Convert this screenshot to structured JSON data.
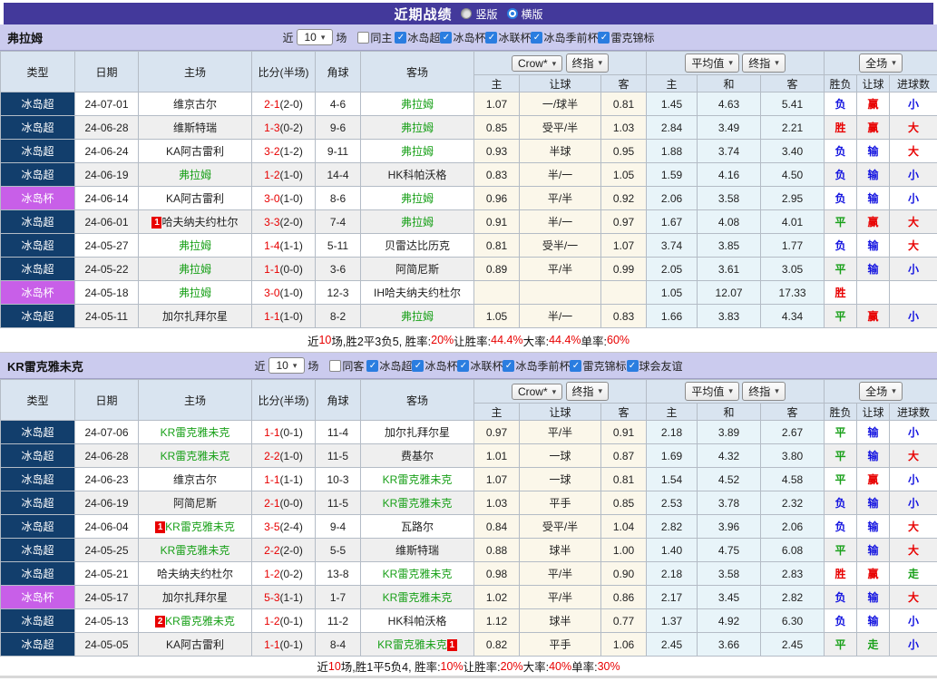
{
  "title_bar": {
    "title": "近期战绩",
    "vertical": "竖版",
    "horizontal": "横版"
  },
  "colors": {
    "title_bg": "#43399b",
    "filter_bg": "#cbcbee",
    "header_bg": "#d9e4f0",
    "league_badge": "#123e6c",
    "cup_badge": "#c85fe8",
    "team_green": "#18a018",
    "win_red": "#e80000",
    "lose_blue": "#1414e0",
    "odds_bg": "#fbf7ea",
    "avg_bg": "#e8f4f9"
  },
  "sections": [
    {
      "team": "弗拉姆",
      "filter": {
        "prefix": "近",
        "count": "10",
        "suffix": "场",
        "same_label": "同主",
        "competitions": [
          "冰岛超",
          "冰岛杯",
          "冰联杯",
          "冰岛季前杯",
          "雷克锦标"
        ]
      },
      "dropdowns": {
        "provider": "Crow*",
        "stage1": "终指",
        "avg": "平均值",
        "stage2": "终指",
        "scope": "全场"
      },
      "columns": [
        "类型",
        "日期",
        "主场",
        "比分(半场)",
        "角球",
        "客场"
      ],
      "sub_columns": [
        "主",
        "让球",
        "客",
        "主",
        "和",
        "客",
        "胜负",
        "让球",
        "进球数"
      ],
      "rows": [
        {
          "lg": "冰岛超",
          "cup": false,
          "date": "24-07-01",
          "home": "维京古尔",
          "hg": false,
          "hb": "",
          "score": "2-1",
          "half": "(2-0)",
          "corner": "4-6",
          "away": "弗拉姆",
          "ag": true,
          "ab": "",
          "aba": "",
          "o": [
            "1.07",
            "一/球半",
            "0.81",
            "1.45",
            "4.63",
            "5.41"
          ],
          "res": [
            [
              "负",
              "b"
            ],
            [
              "赢",
              "r"
            ],
            [
              "小",
              "b"
            ]
          ]
        },
        {
          "lg": "冰岛超",
          "cup": false,
          "date": "24-06-28",
          "home": "维斯特瑞",
          "hg": false,
          "hb": "",
          "score": "1-3",
          "half": "(0-2)",
          "corner": "9-6",
          "away": "弗拉姆",
          "ag": true,
          "ab": "",
          "aba": "",
          "o": [
            "0.85",
            "受平/半",
            "1.03",
            "2.84",
            "3.49",
            "2.21"
          ],
          "res": [
            [
              "胜",
              "r"
            ],
            [
              "赢",
              "r"
            ],
            [
              "大",
              "r"
            ]
          ]
        },
        {
          "lg": "冰岛超",
          "cup": false,
          "date": "24-06-24",
          "home": "KA阿古雷利",
          "hg": false,
          "hb": "",
          "score": "3-2",
          "half": "(1-2)",
          "corner": "9-11",
          "away": "弗拉姆",
          "ag": true,
          "ab": "",
          "aba": "",
          "o": [
            "0.93",
            "半球",
            "0.95",
            "1.88",
            "3.74",
            "3.40"
          ],
          "res": [
            [
              "负",
              "b"
            ],
            [
              "输",
              "b"
            ],
            [
              "大",
              "r"
            ]
          ]
        },
        {
          "lg": "冰岛超",
          "cup": false,
          "date": "24-06-19",
          "home": "弗拉姆",
          "hg": true,
          "hb": "",
          "score": "1-2",
          "half": "(1-0)",
          "corner": "14-4",
          "away": "HK科帕沃格",
          "ag": false,
          "ab": "",
          "aba": "",
          "o": [
            "0.83",
            "半/一",
            "1.05",
            "1.59",
            "4.16",
            "4.50"
          ],
          "res": [
            [
              "负",
              "b"
            ],
            [
              "输",
              "b"
            ],
            [
              "小",
              "b"
            ]
          ]
        },
        {
          "lg": "冰岛杯",
          "cup": true,
          "date": "24-06-14",
          "home": "KA阿古雷利",
          "hg": false,
          "hb": "",
          "score": "3-0",
          "half": "(1-0)",
          "corner": "8-6",
          "away": "弗拉姆",
          "ag": true,
          "ab": "",
          "aba": "",
          "o": [
            "0.96",
            "平/半",
            "0.92",
            "2.06",
            "3.58",
            "2.95"
          ],
          "res": [
            [
              "负",
              "b"
            ],
            [
              "输",
              "b"
            ],
            [
              "小",
              "b"
            ]
          ]
        },
        {
          "lg": "冰岛超",
          "cup": false,
          "date": "24-06-01",
          "home": "哈夫纳夫约杜尔",
          "hg": false,
          "hb": "1",
          "score": "3-3",
          "half": "(2-0)",
          "corner": "7-4",
          "away": "弗拉姆",
          "ag": true,
          "ab": "",
          "aba": "",
          "o": [
            "0.91",
            "半/一",
            "0.97",
            "1.67",
            "4.08",
            "4.01"
          ],
          "res": [
            [
              "平",
              "g"
            ],
            [
              "赢",
              "r"
            ],
            [
              "大",
              "r"
            ]
          ]
        },
        {
          "lg": "冰岛超",
          "cup": false,
          "date": "24-05-27",
          "home": "弗拉姆",
          "hg": true,
          "hb": "",
          "score": "1-4",
          "half": "(1-1)",
          "corner": "5-11",
          "away": "贝雷达比历克",
          "ag": false,
          "ab": "",
          "aba": "",
          "o": [
            "0.81",
            "受半/一",
            "1.07",
            "3.74",
            "3.85",
            "1.77"
          ],
          "res": [
            [
              "负",
              "b"
            ],
            [
              "输",
              "b"
            ],
            [
              "大",
              "r"
            ]
          ]
        },
        {
          "lg": "冰岛超",
          "cup": false,
          "date": "24-05-22",
          "home": "弗拉姆",
          "hg": true,
          "hb": "",
          "score": "1-1",
          "half": "(0-0)",
          "corner": "3-6",
          "away": "阿简尼斯",
          "ag": false,
          "ab": "",
          "aba": "",
          "o": [
            "0.89",
            "平/半",
            "0.99",
            "2.05",
            "3.61",
            "3.05"
          ],
          "res": [
            [
              "平",
              "g"
            ],
            [
              "输",
              "b"
            ],
            [
              "小",
              "b"
            ]
          ]
        },
        {
          "lg": "冰岛杯",
          "cup": true,
          "date": "24-05-18",
          "home": "弗拉姆",
          "hg": true,
          "hb": "",
          "score": "3-0",
          "half": "(1-0)",
          "corner": "12-3",
          "away": "IH哈夫纳夫约杜尔",
          "ag": false,
          "ab": "",
          "aba": "",
          "o": [
            "",
            "",
            "",
            "1.05",
            "12.07",
            "17.33"
          ],
          "res": [
            [
              "胜",
              "r"
            ],
            [
              "",
              ""
            ],
            [
              "",
              ""
            ]
          ]
        },
        {
          "lg": "冰岛超",
          "cup": false,
          "date": "24-05-11",
          "home": "加尔扎拜尔星",
          "hg": false,
          "hb": "",
          "score": "1-1",
          "half": "(1-0)",
          "corner": "8-2",
          "away": "弗拉姆",
          "ag": true,
          "ab": "",
          "aba": "",
          "o": [
            "1.05",
            "半/一",
            "0.83",
            "1.66",
            "3.83",
            "4.34"
          ],
          "res": [
            [
              "平",
              "g"
            ],
            [
              "赢",
              "r"
            ],
            [
              "小",
              "b"
            ]
          ]
        }
      ],
      "summary_parts": [
        [
          "近",
          0
        ],
        [
          "10",
          1
        ],
        [
          "场,胜2平3负5, 胜率:",
          0
        ],
        [
          "20%",
          1
        ],
        [
          " 让胜率:",
          0
        ],
        [
          "44.4%",
          1
        ],
        [
          " 大率:",
          0
        ],
        [
          "44.4%",
          1
        ],
        [
          " 单率:",
          0
        ],
        [
          "60%",
          1
        ]
      ]
    },
    {
      "team": "KR雷克雅未克",
      "filter": {
        "prefix": "近",
        "count": "10",
        "suffix": "场",
        "same_label": "同客",
        "competitions": [
          "冰岛超",
          "冰岛杯",
          "冰联杯",
          "冰岛季前杯",
          "雷克锦标",
          "球会友谊"
        ]
      },
      "dropdowns": {
        "provider": "Crow*",
        "stage1": "终指",
        "avg": "平均值",
        "stage2": "终指",
        "scope": "全场"
      },
      "columns": [
        "类型",
        "日期",
        "主场",
        "比分(半场)",
        "角球",
        "客场"
      ],
      "sub_columns": [
        "主",
        "让球",
        "客",
        "主",
        "和",
        "客",
        "胜负",
        "让球",
        "进球数"
      ],
      "rows": [
        {
          "lg": "冰岛超",
          "cup": false,
          "date": "24-07-06",
          "home": "KR雷克雅未克",
          "hg": true,
          "hb": "",
          "score": "1-1",
          "half": "(0-1)",
          "corner": "11-4",
          "away": "加尔扎拜尔星",
          "ag": false,
          "ab": "",
          "aba": "",
          "o": [
            "0.97",
            "平/半",
            "0.91",
            "2.18",
            "3.89",
            "2.67"
          ],
          "res": [
            [
              "平",
              "g"
            ],
            [
              "输",
              "b"
            ],
            [
              "小",
              "b"
            ]
          ]
        },
        {
          "lg": "冰岛超",
          "cup": false,
          "date": "24-06-28",
          "home": "KR雷克雅未克",
          "hg": true,
          "hb": "",
          "score": "2-2",
          "half": "(1-0)",
          "corner": "11-5",
          "away": "费基尔",
          "ag": false,
          "ab": "",
          "aba": "",
          "o": [
            "1.01",
            "一球",
            "0.87",
            "1.69",
            "4.32",
            "3.80"
          ],
          "res": [
            [
              "平",
              "g"
            ],
            [
              "输",
              "b"
            ],
            [
              "大",
              "r"
            ]
          ]
        },
        {
          "lg": "冰岛超",
          "cup": false,
          "date": "24-06-23",
          "home": "维京古尔",
          "hg": false,
          "hb": "",
          "score": "1-1",
          "half": "(1-1)",
          "corner": "10-3",
          "away": "KR雷克雅未克",
          "ag": true,
          "ab": "",
          "aba": "",
          "o": [
            "1.07",
            "一球",
            "0.81",
            "1.54",
            "4.52",
            "4.58"
          ],
          "res": [
            [
              "平",
              "g"
            ],
            [
              "赢",
              "r"
            ],
            [
              "小",
              "b"
            ]
          ]
        },
        {
          "lg": "冰岛超",
          "cup": false,
          "date": "24-06-19",
          "home": "阿简尼斯",
          "hg": false,
          "hb": "",
          "score": "2-1",
          "half": "(0-0)",
          "corner": "11-5",
          "away": "KR雷克雅未克",
          "ag": true,
          "ab": "",
          "aba": "",
          "o": [
            "1.03",
            "平手",
            "0.85",
            "2.53",
            "3.78",
            "2.32"
          ],
          "res": [
            [
              "负",
              "b"
            ],
            [
              "输",
              "b"
            ],
            [
              "小",
              "b"
            ]
          ]
        },
        {
          "lg": "冰岛超",
          "cup": false,
          "date": "24-06-04",
          "home": "KR雷克雅未克",
          "hg": true,
          "hb": "1",
          "score": "3-5",
          "half": "(2-4)",
          "corner": "9-4",
          "away": "瓦路尔",
          "ag": false,
          "ab": "",
          "aba": "",
          "o": [
            "0.84",
            "受平/半",
            "1.04",
            "2.82",
            "3.96",
            "2.06"
          ],
          "res": [
            [
              "负",
              "b"
            ],
            [
              "输",
              "b"
            ],
            [
              "大",
              "r"
            ]
          ]
        },
        {
          "lg": "冰岛超",
          "cup": false,
          "date": "24-05-25",
          "home": "KR雷克雅未克",
          "hg": true,
          "hb": "",
          "score": "2-2",
          "half": "(2-0)",
          "corner": "5-5",
          "away": "维斯特瑞",
          "ag": false,
          "ab": "",
          "aba": "",
          "o": [
            "0.88",
            "球半",
            "1.00",
            "1.40",
            "4.75",
            "6.08"
          ],
          "res": [
            [
              "平",
              "g"
            ],
            [
              "输",
              "b"
            ],
            [
              "大",
              "r"
            ]
          ]
        },
        {
          "lg": "冰岛超",
          "cup": false,
          "date": "24-05-21",
          "home": "哈夫纳夫约杜尔",
          "hg": false,
          "hb": "",
          "score": "1-2",
          "half": "(0-2)",
          "corner": "13-8",
          "away": "KR雷克雅未克",
          "ag": true,
          "ab": "",
          "aba": "",
          "o": [
            "0.98",
            "平/半",
            "0.90",
            "2.18",
            "3.58",
            "2.83"
          ],
          "res": [
            [
              "胜",
              "r"
            ],
            [
              "赢",
              "r"
            ],
            [
              "走",
              "g"
            ]
          ]
        },
        {
          "lg": "冰岛杯",
          "cup": true,
          "date": "24-05-17",
          "home": "加尔扎拜尔星",
          "hg": false,
          "hb": "",
          "score": "5-3",
          "half": "(1-1)",
          "corner": "1-7",
          "away": "KR雷克雅未克",
          "ag": true,
          "ab": "",
          "aba": "",
          "o": [
            "1.02",
            "平/半",
            "0.86",
            "2.17",
            "3.45",
            "2.82"
          ],
          "res": [
            [
              "负",
              "b"
            ],
            [
              "输",
              "b"
            ],
            [
              "大",
              "r"
            ]
          ]
        },
        {
          "lg": "冰岛超",
          "cup": false,
          "date": "24-05-13",
          "home": "KR雷克雅未克",
          "hg": true,
          "hb": "2",
          "score": "1-2",
          "half": "(0-1)",
          "corner": "11-2",
          "away": "HK科帕沃格",
          "ag": false,
          "ab": "",
          "aba": "",
          "o": [
            "1.12",
            "球半",
            "0.77",
            "1.37",
            "4.92",
            "6.30"
          ],
          "res": [
            [
              "负",
              "b"
            ],
            [
              "输",
              "b"
            ],
            [
              "小",
              "b"
            ]
          ]
        },
        {
          "lg": "冰岛超",
          "cup": false,
          "date": "24-05-05",
          "home": "KA阿古雷利",
          "hg": false,
          "hb": "",
          "score": "1-1",
          "half": "(0-1)",
          "corner": "8-4",
          "away": "KR雷克雅未克",
          "ag": true,
          "ab": "",
          "aba": "1",
          "o": [
            "0.82",
            "平手",
            "1.06",
            "2.45",
            "3.66",
            "2.45"
          ],
          "res": [
            [
              "平",
              "g"
            ],
            [
              "走",
              "g"
            ],
            [
              "小",
              "b"
            ]
          ]
        }
      ],
      "summary_parts": [
        [
          "近",
          0
        ],
        [
          "10",
          1
        ],
        [
          "场,胜1平5负4, 胜率:",
          0
        ],
        [
          "10%",
          1
        ],
        [
          " 让胜率:",
          0
        ],
        [
          "20%",
          1
        ],
        [
          " 大率:",
          0
        ],
        [
          "40%",
          1
        ],
        [
          " 单率:",
          0
        ],
        [
          "30%",
          1
        ]
      ]
    }
  ]
}
